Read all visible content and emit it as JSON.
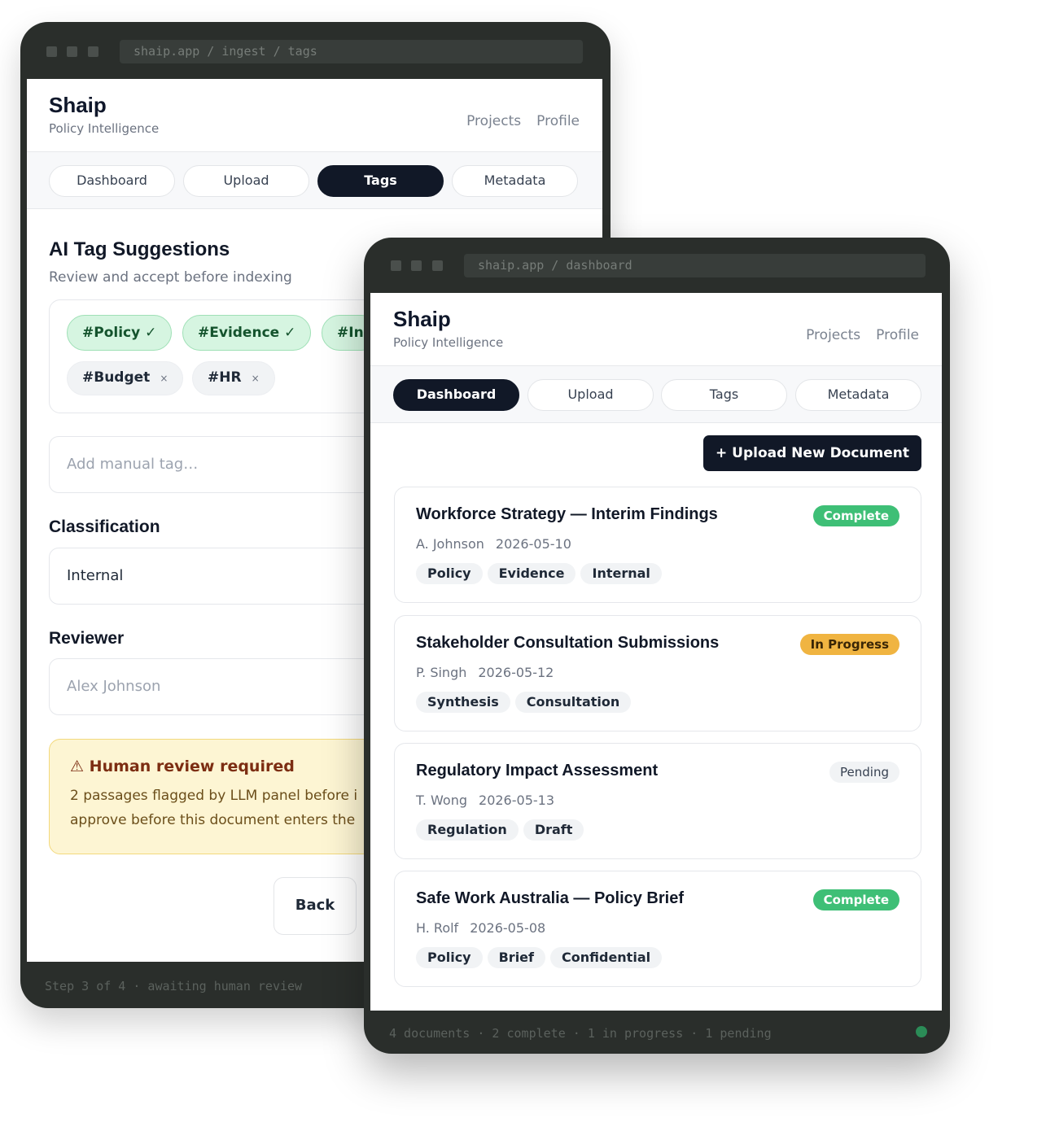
{
  "back_window": {
    "url": "shaip.app / ingest / tags",
    "brand": "Shaip",
    "brand_sub": "Policy Intelligence",
    "nav": [
      "Projects",
      "Profile"
    ],
    "tabs": [
      "Dashboard",
      "Upload",
      "Tags",
      "Metadata"
    ],
    "active_tab": "Tags",
    "ai_title": "AI Tag Suggestions",
    "ai_sub": "Review and accept before indexing",
    "accepted_tags": [
      "#Policy ✓",
      "#Evidence ✓",
      "#In"
    ],
    "rejected_tags": [
      "#Budget",
      "#HR"
    ],
    "remove_symbol": "×",
    "manual_placeholder": "Add manual tag…",
    "classification_label": "Classification",
    "classification_value": "Internal",
    "reviewer_label": "Reviewer",
    "reviewer_placeholder": "Alex Johnson",
    "alert_title": "Human review required",
    "alert_icon": "⚠",
    "alert_line1": "2 passages flagged by LLM panel before i",
    "alert_line2": "approve before this document enters the",
    "back_button": "Back",
    "footer": "Step 3 of 4 · awaiting human review"
  },
  "front_window": {
    "url": "shaip.app / dashboard",
    "brand": "Shaip",
    "brand_sub": "Policy Intelligence",
    "nav": [
      "Projects",
      "Profile"
    ],
    "tabs": [
      "Dashboard",
      "Upload",
      "Tags",
      "Metadata"
    ],
    "active_tab": "Dashboard",
    "upload_button": "+ Upload New Document",
    "documents": [
      {
        "title": "Workforce Strategy — Interim Findings",
        "author": "A. Johnson",
        "date": "2026-05-10",
        "status": "Complete",
        "tags": [
          "Policy",
          "Evidence",
          "Internal"
        ]
      },
      {
        "title": "Stakeholder Consultation Submissions",
        "author": "P. Singh",
        "date": "2026-05-12",
        "status": "In Progress",
        "tags": [
          "Synthesis",
          "Consultation"
        ]
      },
      {
        "title": "Regulatory Impact Assessment",
        "author": "T. Wong",
        "date": "2026-05-13",
        "status": "Pending",
        "tags": [
          "Regulation",
          "Draft"
        ]
      },
      {
        "title": "Safe Work Australia — Policy Brief",
        "author": "H. Rolf",
        "date": "2026-05-08",
        "status": "Complete",
        "tags": [
          "Policy",
          "Brief",
          "Confidential"
        ]
      }
    ],
    "footer": "4 documents · 2 complete · 1 in progress · 1 pending"
  },
  "colors": {
    "frame": "#2a2e2b",
    "primary": "#111827",
    "complete": "#3ebf76",
    "in_progress": "#f0b441",
    "accepted_tag_bg": "#d6f5e1",
    "alert_bg": "#fdf5d3",
    "status_dot": "#2b8c57"
  }
}
